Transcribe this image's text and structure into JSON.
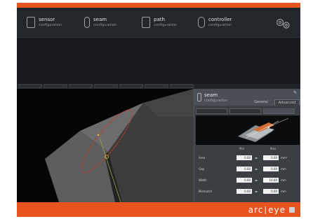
{
  "nav": {
    "items": [
      {
        "title": "sensor",
        "sub": "configuration",
        "icon": "sensor-icon"
      },
      {
        "title": "seam",
        "sub": "configuration",
        "icon": "seam-icon"
      },
      {
        "title": "path",
        "sub": "configuration",
        "icon": "path-icon"
      },
      {
        "title": "controller",
        "sub": "configuration",
        "icon": "controller-icon"
      }
    ],
    "gear_icon": "gears-icon"
  },
  "panel": {
    "title": "seam",
    "subtitle": "configuration",
    "tabs": [
      "General",
      "Advanced"
    ],
    "wrench_icon": "wrench-icon",
    "columns": {
      "min": "Min",
      "max": "Max"
    },
    "rows": [
      {
        "label": "Area",
        "min": "0.00",
        "max": "0.00",
        "unit": "mm²"
      },
      {
        "label": "Gap",
        "min": "0.00",
        "max": "0.00",
        "unit": "mm"
      },
      {
        "label": "Width",
        "min": "0.00",
        "max": "10.00",
        "unit": "mm"
      },
      {
        "label": "Mismatch",
        "min": "0.00",
        "max": "0.00",
        "unit": "mm"
      }
    ]
  },
  "footer": {
    "logo_left": "arc",
    "logo_right": "eye"
  },
  "colors": {
    "accent": "#e8541f",
    "background": "#1d1f22",
    "panel": "#3b3f44"
  }
}
